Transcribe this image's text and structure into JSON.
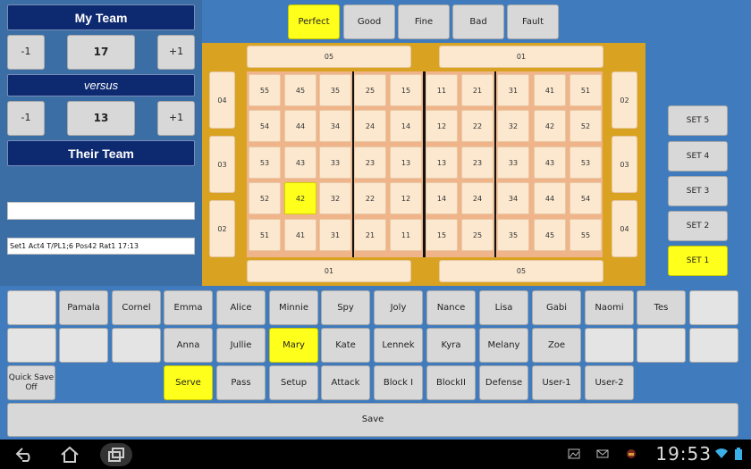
{
  "left_panel": {
    "my_team_label": "My Team",
    "my_score": "17",
    "minus_label": "-1",
    "plus_label": "+1",
    "versus_label": "versus",
    "their_score": "13",
    "their_team_label": "Their Team",
    "notes_field": "",
    "log_text": "Set1 Act4 T/PL1;6 Pos42 Rat1 17:13"
  },
  "ratings": [
    "Perfect",
    "Good",
    "Fine",
    "Bad",
    "Fault"
  ],
  "selected_rating": "Perfect",
  "court": {
    "top_left_zone": "05",
    "top_right_zone": "01",
    "bottom_left_zone": "01",
    "bottom_right_zone": "05",
    "left_zones": [
      "04",
      "03",
      "02"
    ],
    "right_zones": [
      "02",
      "03",
      "04"
    ],
    "rows": [
      [
        "55",
        "45",
        "35",
        "25",
        "15",
        "11",
        "21",
        "31",
        "41",
        "51"
      ],
      [
        "54",
        "44",
        "34",
        "24",
        "14",
        "12",
        "22",
        "32",
        "42",
        "52"
      ],
      [
        "53",
        "43",
        "33",
        "23",
        "13",
        "13",
        "23",
        "33",
        "43",
        "53"
      ],
      [
        "52",
        "42",
        "32",
        "22",
        "12",
        "14",
        "24",
        "34",
        "44",
        "54"
      ],
      [
        "51",
        "41",
        "31",
        "21",
        "11",
        "15",
        "25",
        "35",
        "45",
        "55"
      ]
    ],
    "selected_cell": "42"
  },
  "sets": [
    "SET 5",
    "SET 4",
    "SET 3",
    "SET 2",
    "SET 1"
  ],
  "selected_set": "SET 1",
  "players_row1": [
    "",
    "Pamala",
    "Cornel",
    "Emma",
    "Alice",
    "Minnie",
    "Spy",
    "Joly",
    "Nance",
    "Lisa",
    "Gabi",
    "Naomi",
    "Tes",
    ""
  ],
  "players_row2": [
    "",
    "",
    "",
    "Anna",
    "Jullie",
    "Mary",
    "Kate",
    "Lennek",
    "Kyra",
    "Melany",
    "Zoe",
    "",
    "",
    ""
  ],
  "selected_player": "Mary",
  "quick_save_label": "Quick Save Off",
  "actions": [
    "Serve",
    "Pass",
    "Setup",
    "Attack",
    "Block I",
    "BlockII",
    "Defense",
    "User-1",
    "User-2"
  ],
  "selected_action": "Serve",
  "save_label": "Save",
  "status_bar": {
    "time": "19:53"
  },
  "colors": {
    "selected": "#ffff1c",
    "header": "#0d2970",
    "court": "#d9a321",
    "panel": "#3f7bbd"
  }
}
